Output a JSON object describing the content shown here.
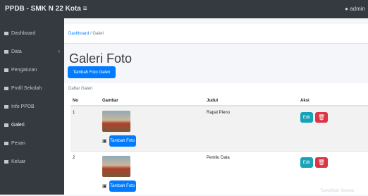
{
  "app": {
    "brand": "PPDB - SMK N 22 Kota",
    "user": "admin"
  },
  "sidebar": {
    "items": [
      {
        "label": "Dashboard"
      },
      {
        "label": "Data"
      },
      {
        "label": "Pengaturan"
      },
      {
        "label": "Profil Sekolah"
      },
      {
        "label": "Info PPDB"
      },
      {
        "label": "Galeri"
      },
      {
        "label": "Pesan"
      },
      {
        "label": "Keluar"
      }
    ]
  },
  "breadcrumb": {
    "home": "Dashboard",
    "separator": " / ",
    "current": "Galeri"
  },
  "page": {
    "title": "Galeri Foto",
    "add_button": "Tambah Foto Galeri"
  },
  "card": {
    "title": "Daftar Galeri"
  },
  "table": {
    "headers": [
      "No",
      "Gambar",
      "Judul",
      "Aksi"
    ],
    "rows": [
      {
        "no": "1",
        "judul": "Rapat Pleno",
        "photo_button": "Tambah Foto",
        "edit": "Edit",
        "delete": "🗑"
      },
      {
        "no": "2",
        "judul": "Pemilu Data",
        "photo_button": "Tambah Foto",
        "edit": "Edit",
        "delete": "🗑"
      }
    ]
  },
  "footer": {
    "text": "Tampilkan Semua"
  }
}
